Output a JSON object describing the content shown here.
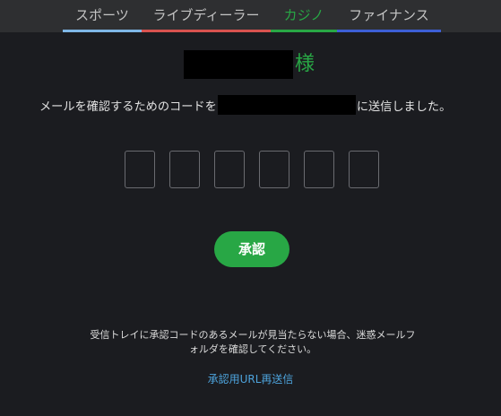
{
  "nav": {
    "tabs": [
      {
        "label": "スポーツ",
        "color": "#7fb7e6"
      },
      {
        "label": "ライブディーラー",
        "color": "#d9534f"
      },
      {
        "label": "カジノ",
        "color": "#28a745"
      },
      {
        "label": "ファイナンス",
        "color": "#3d5fd6"
      }
    ],
    "active_tab": "カジノ",
    "active_color": "#28a745"
  },
  "greeting": {
    "honorific": "様"
  },
  "message": {
    "before": "メールを確認するためのコードを",
    "after": "に送信しました。"
  },
  "code_inputs": {
    "count": 6,
    "values": [
      "",
      "",
      "",
      "",
      "",
      ""
    ]
  },
  "approve_button": {
    "label": "承認",
    "color": "#28a745"
  },
  "note": {
    "text": "受信トレイに承認コードのあるメールが見当たらない場合、迷惑メールフォルダを確認してください。"
  },
  "resend_link": {
    "label": "承認用URL再送信",
    "color": "#4da3dc"
  }
}
